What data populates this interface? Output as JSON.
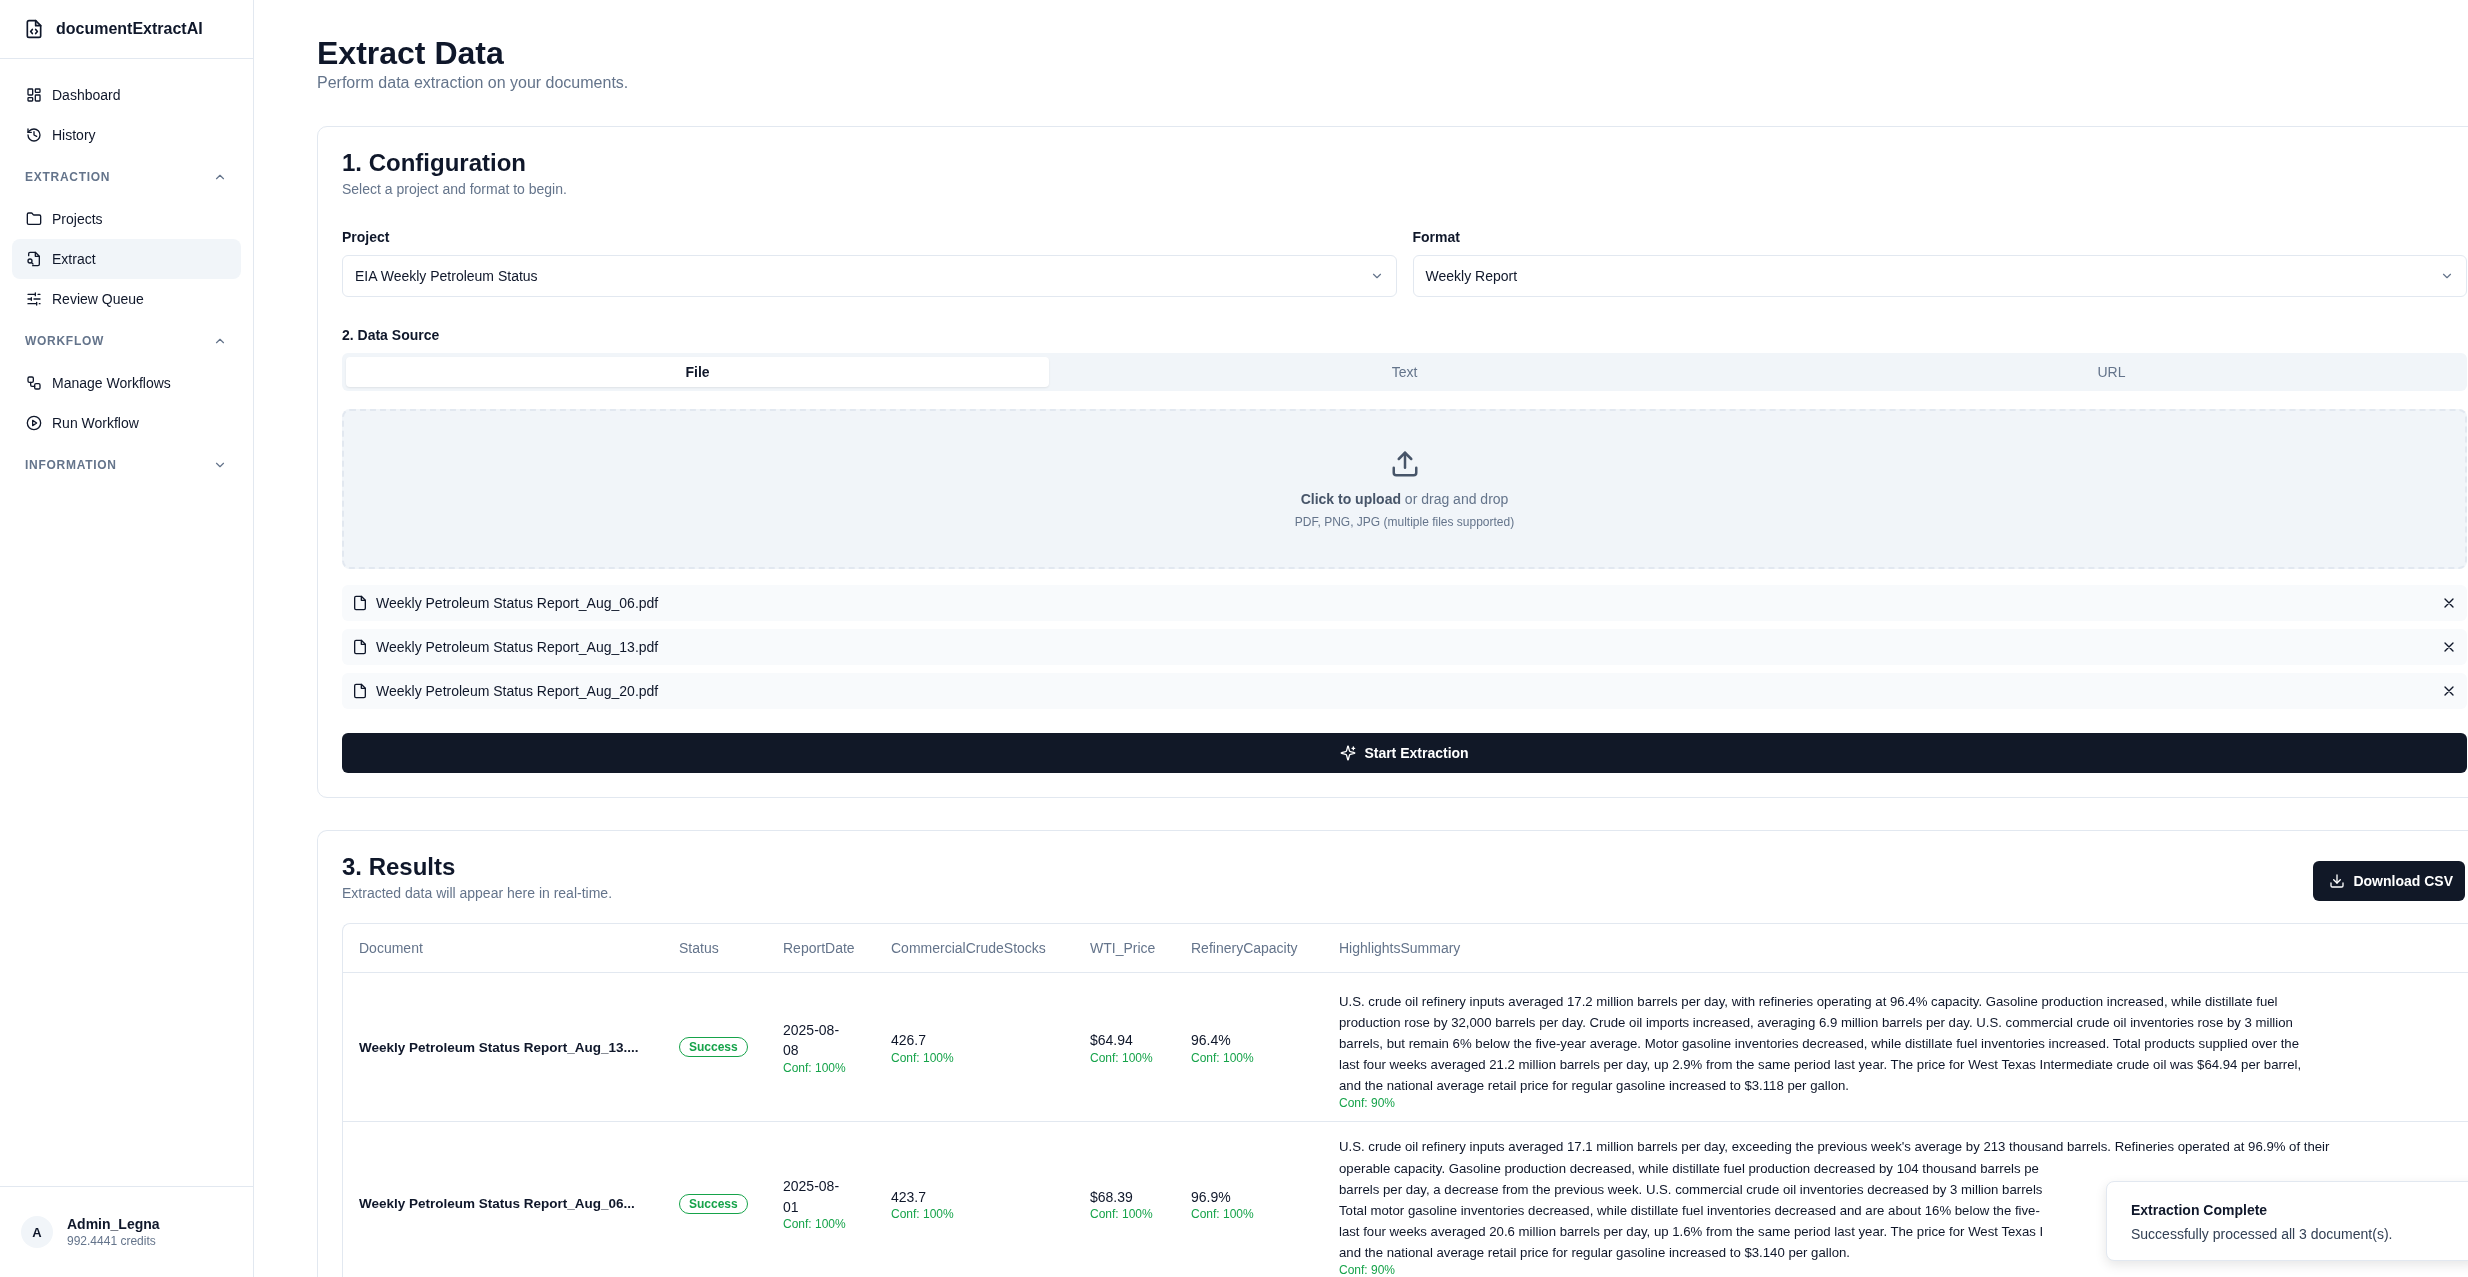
{
  "app": {
    "name": "documentExtractAI"
  },
  "sidebar": {
    "top_items": [
      {
        "label": "Dashboard",
        "selected": false
      },
      {
        "label": "History",
        "selected": false
      }
    ],
    "sections": [
      {
        "title": "EXTRACTION",
        "expanded": true,
        "items": [
          {
            "label": "Projects",
            "selected": false
          },
          {
            "label": "Extract",
            "selected": true
          },
          {
            "label": "Review Queue",
            "selected": false
          }
        ]
      },
      {
        "title": "WORKFLOW",
        "expanded": true,
        "items": [
          {
            "label": "Manage Workflows",
            "selected": false
          },
          {
            "label": "Run Workflow",
            "selected": false
          }
        ]
      },
      {
        "title": "INFORMATION",
        "expanded": false
      }
    ],
    "user": {
      "initial": "A",
      "name": "Admin_Legna",
      "credits": "992.4441 credits"
    }
  },
  "page": {
    "title": "Extract Data",
    "subtitle": "Perform data extraction on your documents."
  },
  "configuration": {
    "heading": "1. Configuration",
    "subheading": "Select a project and format to begin.",
    "project": {
      "label": "Project",
      "value": "EIA Weekly Petroleum Status"
    },
    "format": {
      "label": "Format",
      "value": "Weekly Report"
    },
    "data_source": {
      "label": "2. Data Source",
      "tabs": [
        {
          "label": "File",
          "selected": true
        },
        {
          "label": "Text",
          "selected": false
        },
        {
          "label": "URL",
          "selected": false
        }
      ]
    },
    "upload": {
      "text": "**Click to upload** or drag and drop",
      "hint": "PDF, PNG, JPG (multiple files supported)"
    },
    "files": [
      "Weekly Petroleum Status Report_Aug_06.pdf",
      "Weekly Petroleum Status Report_Aug_13.pdf",
      "Weekly Petroleum Status Report_Aug_20.pdf"
    ],
    "start_button": "Start Extraction"
  },
  "results": {
    "heading": "3. Results",
    "subheading": "Extracted data will appear here in real-time.",
    "download_button": "Download CSV",
    "columns": [
      "Document",
      "Status",
      "ReportDate",
      "CommercialCrudeStocks",
      "WTI_Price",
      "RefineryCapacity",
      "HighlightsSummary"
    ],
    "rows": [
      {
        "cells": [
          {
            "kind": "document",
            "value": "Weekly Petroleum Status Report_Aug_13...."
          },
          {
            "kind": "status",
            "value": "Success",
            "color": "#16a34a"
          },
          {
            "kind": "date",
            "value": "2025-08-08",
            "conf": "Conf: 100%"
          },
          {
            "kind": "number",
            "value": "426.7",
            "conf": "Conf: 100%"
          },
          {
            "kind": "number",
            "value": "$64.94",
            "conf": "Conf: 100%"
          },
          {
            "kind": "number",
            "value": "96.4%",
            "conf": "Conf: 100%"
          },
          {
            "kind": "summary",
            "conf": "Conf: 90%",
            "lines": [
              "U.S. crude oil refinery inputs averaged 17.2 million barrels per day, with refineries operating at 96.4% capacity. Gasoline production increased, while distillate fuel",
              "production rose by 32,000 barrels per day. Crude oil imports increased, averaging 6.9 million barrels per day. U.S. commercial crude oil inventories rose by 3 million",
              "barrels, but remain 6% below the five-year average. Motor gasoline inventories decreased, while distillate fuel inventories increased. Total products supplied over the",
              "last four weeks averaged 21.2 million barrels per day, up 2.9% from the same period last year. The price for West Texas Intermediate crude oil was $64.94 per barrel,",
              "and the national average retail price for regular gasoline increased to $3.118 per gallon."
            ]
          }
        ]
      },
      {
        "cells": [
          {
            "kind": "document",
            "value": "Weekly Petroleum Status Report_Aug_06..."
          },
          {
            "kind": "status",
            "value": "Success",
            "color": "#16a34a"
          },
          {
            "kind": "date",
            "value": "2025-08-01",
            "conf": "Conf: 100%"
          },
          {
            "kind": "number",
            "value": "423.7",
            "conf": "Conf: 100%"
          },
          {
            "kind": "number",
            "value": "$68.39",
            "conf": "Conf: 100%"
          },
          {
            "kind": "number",
            "value": "96.9%",
            "conf": "Conf: 100%"
          },
          {
            "kind": "summary",
            "conf": "Conf: 90%",
            "lines": [
              "U.S. crude oil refinery inputs averaged 17.1 million barrels per day, exceeding the previous week's average by 213 thousand barrels. Refineries operated at 96.9% of their",
              "operable capacity. Gasoline production decreased, while distillate fuel production decreased by 104 thousand barrels pe",
              "barrels per day, a decrease from the previous week. U.S. commercial crude oil inventories decreased by 3 million barrels",
              "Total motor gasoline inventories decreased, while distillate fuel inventories decreased and are about 16% below the five-",
              "last four weeks averaged 20.6 million barrels per day, up 1.6% from the same period last year. The price for West Texas I",
              "and the national average retail price for regular gasoline increased to $3.140 per gallon."
            ]
          }
        ]
      }
    ]
  },
  "toast": {
    "title": "Extraction Complete",
    "message": "Successfully processed all 3 document(s)."
  }
}
